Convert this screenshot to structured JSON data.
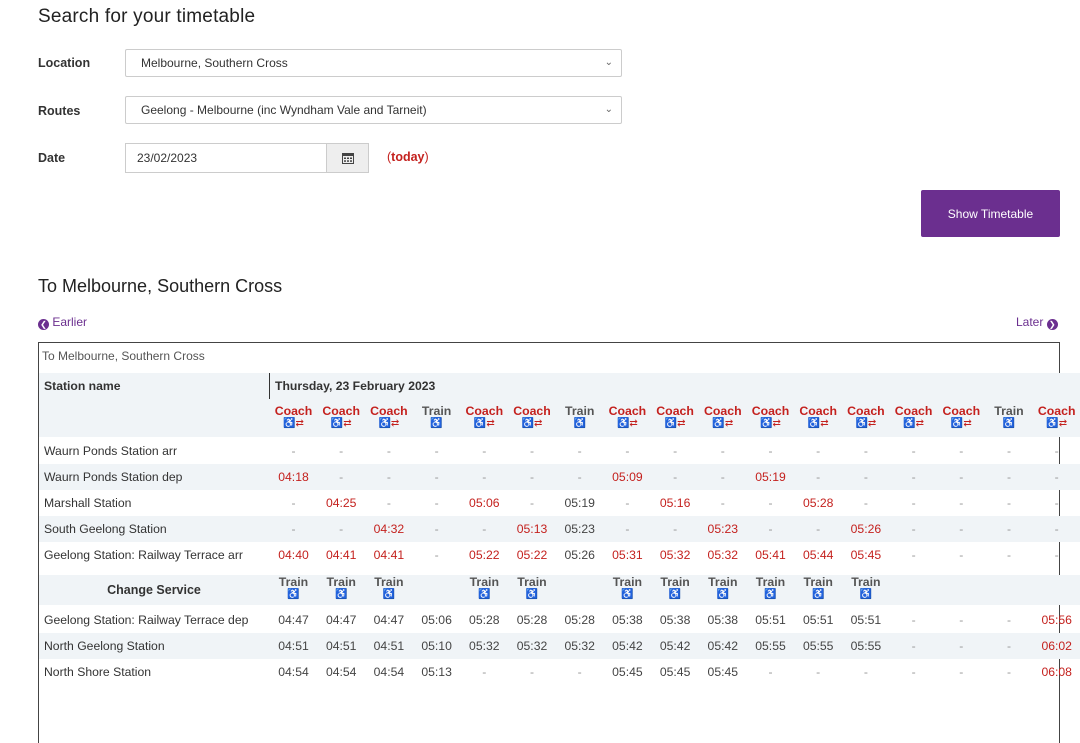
{
  "search": {
    "heading": "Search for your timetable",
    "location_label": "Location",
    "location_value": "Melbourne, Southern Cross",
    "routes_label": "Routes",
    "routes_value": "Geelong - Melbourne (inc Wyndham Vale and Tarneit)",
    "date_label": "Date",
    "date_value": "23/02/2023",
    "today_open": "(",
    "today_text": "today",
    "today_close": ")",
    "show_button": "Show Timetable",
    "calendar_icon": "calendar-icon",
    "chevron_icon": "chevron-down-icon"
  },
  "timetable": {
    "heading": "To Melbourne, Southern Cross",
    "earlier": "Earlier",
    "later": "Later",
    "caption": "To Melbourne, Southern Cross",
    "station_header": "Station name",
    "date_header": "Thursday, 23 February 2023",
    "change_label": "Change Service",
    "colors": {
      "accent": "#6b2f8f",
      "coach": "#c4211e",
      "row_alt": "#f0f4f7"
    },
    "modes": [
      "Coach",
      "Coach",
      "Coach",
      "Train",
      "Coach",
      "Coach",
      "Train",
      "Coach",
      "Coach",
      "Coach",
      "Coach",
      "Coach",
      "Coach",
      "Coach",
      "Coach",
      "Train",
      "Coach"
    ],
    "mode_icons": [
      "&⇄",
      "&⇄",
      "&⇄",
      "&",
      "&⇄",
      "&⇄",
      "&",
      "&⇄",
      "&⇄",
      "&⇄",
      "&⇄",
      "&⇄",
      "&⇄",
      "&⇄",
      "&⇄",
      "&",
      "&⇄"
    ],
    "change_modes": [
      "Train",
      "Train",
      "Train",
      "",
      "Train",
      "Train",
      "",
      "Train",
      "Train",
      "Train",
      "Train",
      "Train",
      "Train",
      "",
      "",
      "",
      ""
    ],
    "change_icons": [
      "&",
      "&",
      "&",
      "",
      "&",
      "&",
      "",
      "&",
      "&",
      "&",
      "&",
      "&",
      "&",
      "",
      "",
      "",
      ""
    ],
    "rows_before": [
      {
        "station": "Waurn Ponds Station arr",
        "times": [
          "-",
          "-",
          "-",
          "-",
          "-",
          "-",
          "-",
          "-",
          "-",
          "-",
          "-",
          "-",
          "-",
          "-",
          "-",
          "-",
          "-"
        ]
      },
      {
        "station": "Waurn Ponds Station dep",
        "times": [
          "04:18",
          "-",
          "-",
          "-",
          "-",
          "-",
          "-",
          "05:09",
          "-",
          "-",
          "05:19",
          "-",
          "-",
          "-",
          "-",
          "-",
          "-"
        ]
      },
      {
        "station": "Marshall Station",
        "times": [
          "-",
          "04:25",
          "-",
          "-",
          "05:06",
          "-",
          "05:19",
          "-",
          "05:16",
          "-",
          "-",
          "05:28",
          "-",
          "-",
          "-",
          "-",
          "-"
        ]
      },
      {
        "station": "South Geelong Station",
        "times": [
          "-",
          "-",
          "04:32",
          "-",
          "-",
          "05:13",
          "05:23",
          "-",
          "-",
          "05:23",
          "-",
          "-",
          "05:26",
          "-",
          "-",
          "-",
          "-"
        ]
      },
      {
        "station": "Geelong Station: Railway Terrace arr",
        "times": [
          "04:40",
          "04:41",
          "04:41",
          "-",
          "05:22",
          "05:22",
          "05:26",
          "05:31",
          "05:32",
          "05:32",
          "05:41",
          "05:44",
          "05:45",
          "-",
          "-",
          "-",
          "-"
        ]
      }
    ],
    "rows_after": [
      {
        "station": "Geelong Station: Railway Terrace dep",
        "times": [
          "04:47",
          "04:47",
          "04:47",
          "05:06",
          "05:28",
          "05:28",
          "05:28",
          "05:38",
          "05:38",
          "05:38",
          "05:51",
          "05:51",
          "05:51",
          "-",
          "-",
          "-",
          "05:56"
        ]
      },
      {
        "station": "North Geelong Station",
        "times": [
          "04:51",
          "04:51",
          "04:51",
          "05:10",
          "05:32",
          "05:32",
          "05:32",
          "05:42",
          "05:42",
          "05:42",
          "05:55",
          "05:55",
          "05:55",
          "-",
          "-",
          "-",
          "06:02"
        ]
      },
      {
        "station": "North Shore Station",
        "times": [
          "04:54",
          "04:54",
          "04:54",
          "05:13",
          "-",
          "-",
          "-",
          "05:45",
          "05:45",
          "05:45",
          "-",
          "-",
          "-",
          "-",
          "-",
          "-",
          "06:08"
        ]
      }
    ]
  }
}
